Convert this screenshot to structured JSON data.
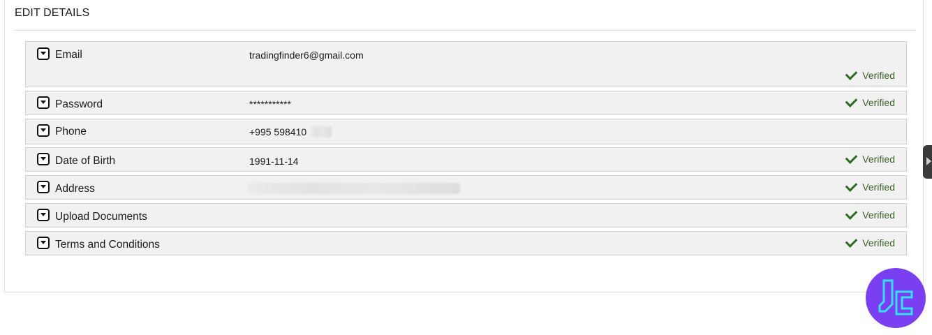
{
  "header": {
    "title": "EDIT DETAILS"
  },
  "rows": [
    {
      "label": "Email",
      "value": "tradingfinder6@gmail.com",
      "status": "Verified"
    },
    {
      "label": "Password",
      "value": "***********",
      "status": "Verified"
    },
    {
      "label": "Phone",
      "value": "+995 598410",
      "status": ""
    },
    {
      "label": "Date of Birth",
      "value": "1991-11-14",
      "status": "Verified"
    },
    {
      "label": "Address",
      "value": "",
      "status": "Verified"
    },
    {
      "label": "Upload Documents",
      "value": "",
      "status": "Verified"
    },
    {
      "label": "Terms and Conditions",
      "value": "",
      "status": "Verified"
    }
  ],
  "icons": {
    "toggle": "chevron-down-box-icon",
    "check": "check-icon",
    "side_tab": "caret-right-icon",
    "logo": "brand-logo-icon"
  },
  "colors": {
    "verified": "#3b5f2a",
    "row_background": "#f1f1f1",
    "logo_background": "#7b3ff2",
    "logo_stroke": "#35e0ff"
  }
}
